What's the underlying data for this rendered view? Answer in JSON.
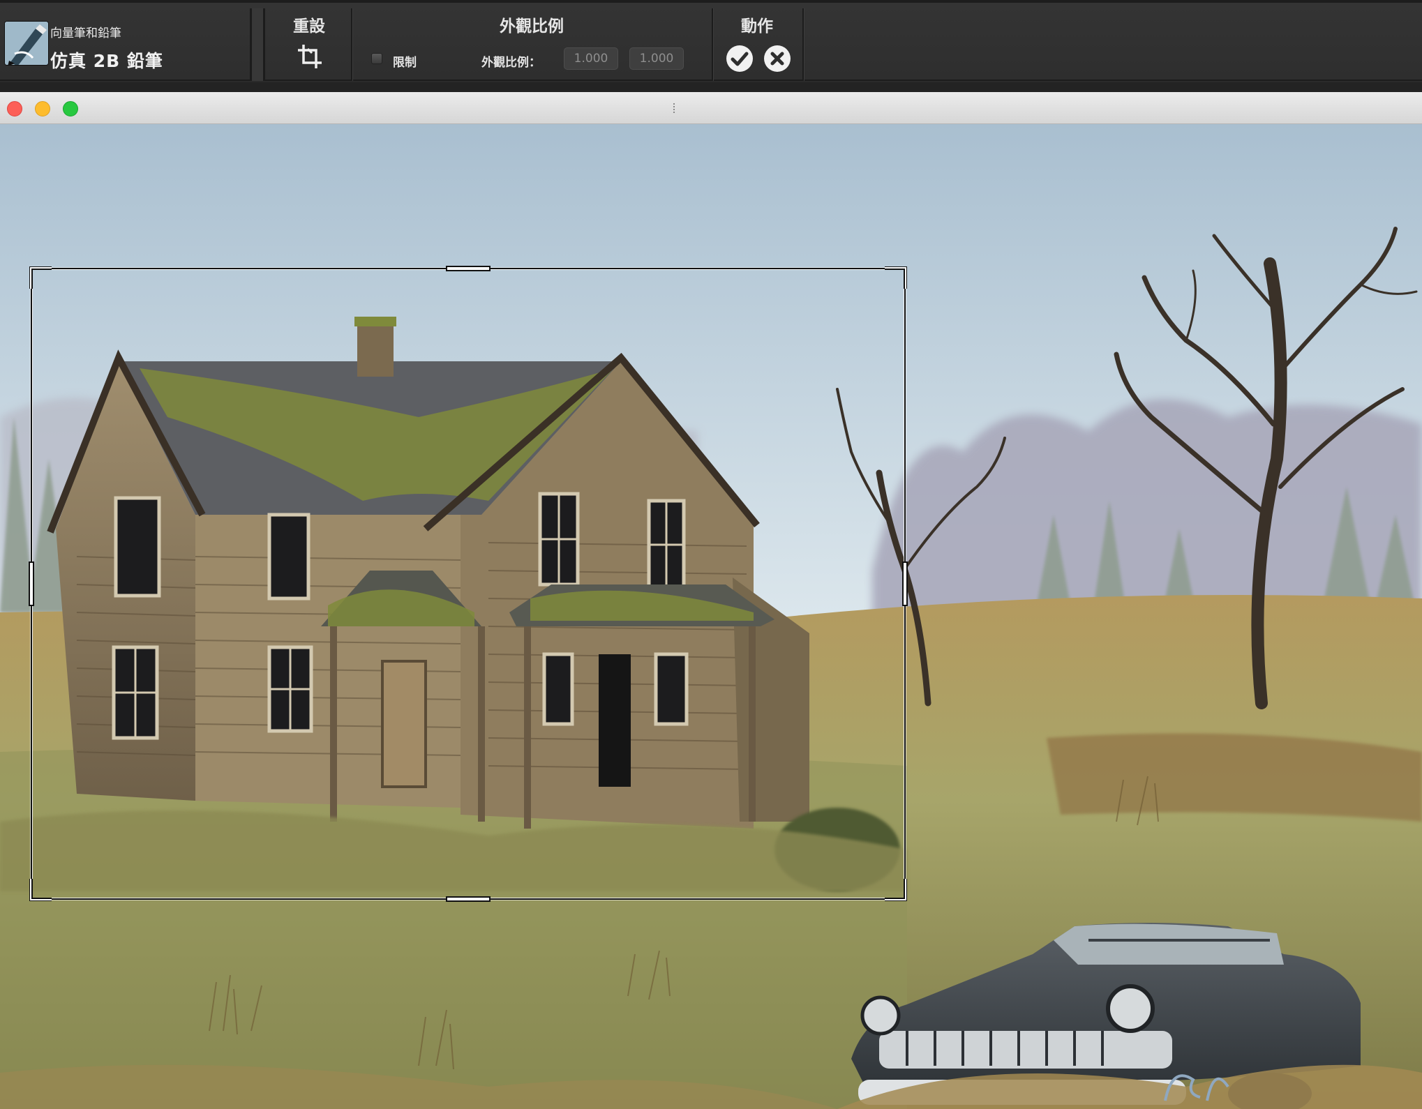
{
  "property_bar": {
    "brush": {
      "category": "向量筆和鉛筆",
      "variant": "仿真 2B 鉛筆",
      "icon": "pencil-brush-icon"
    },
    "reset": {
      "title": "重設",
      "icon": "crop-reset-icon"
    },
    "aspect_ratio": {
      "title": "外觀比例",
      "constrain_label": "限制",
      "constrain_checked": false,
      "ratio_label": "外觀比例：",
      "ratio_width": "1.000",
      "ratio_height": "1.000"
    },
    "actions": {
      "title": "動作",
      "commit_icon": "checkmark-icon",
      "cancel_icon": "cancel-x-icon"
    }
  },
  "document_window": {
    "traffic_lights": [
      "close",
      "minimize",
      "zoom"
    ],
    "canvas_content": "painting",
    "crop_tool_active": true
  }
}
